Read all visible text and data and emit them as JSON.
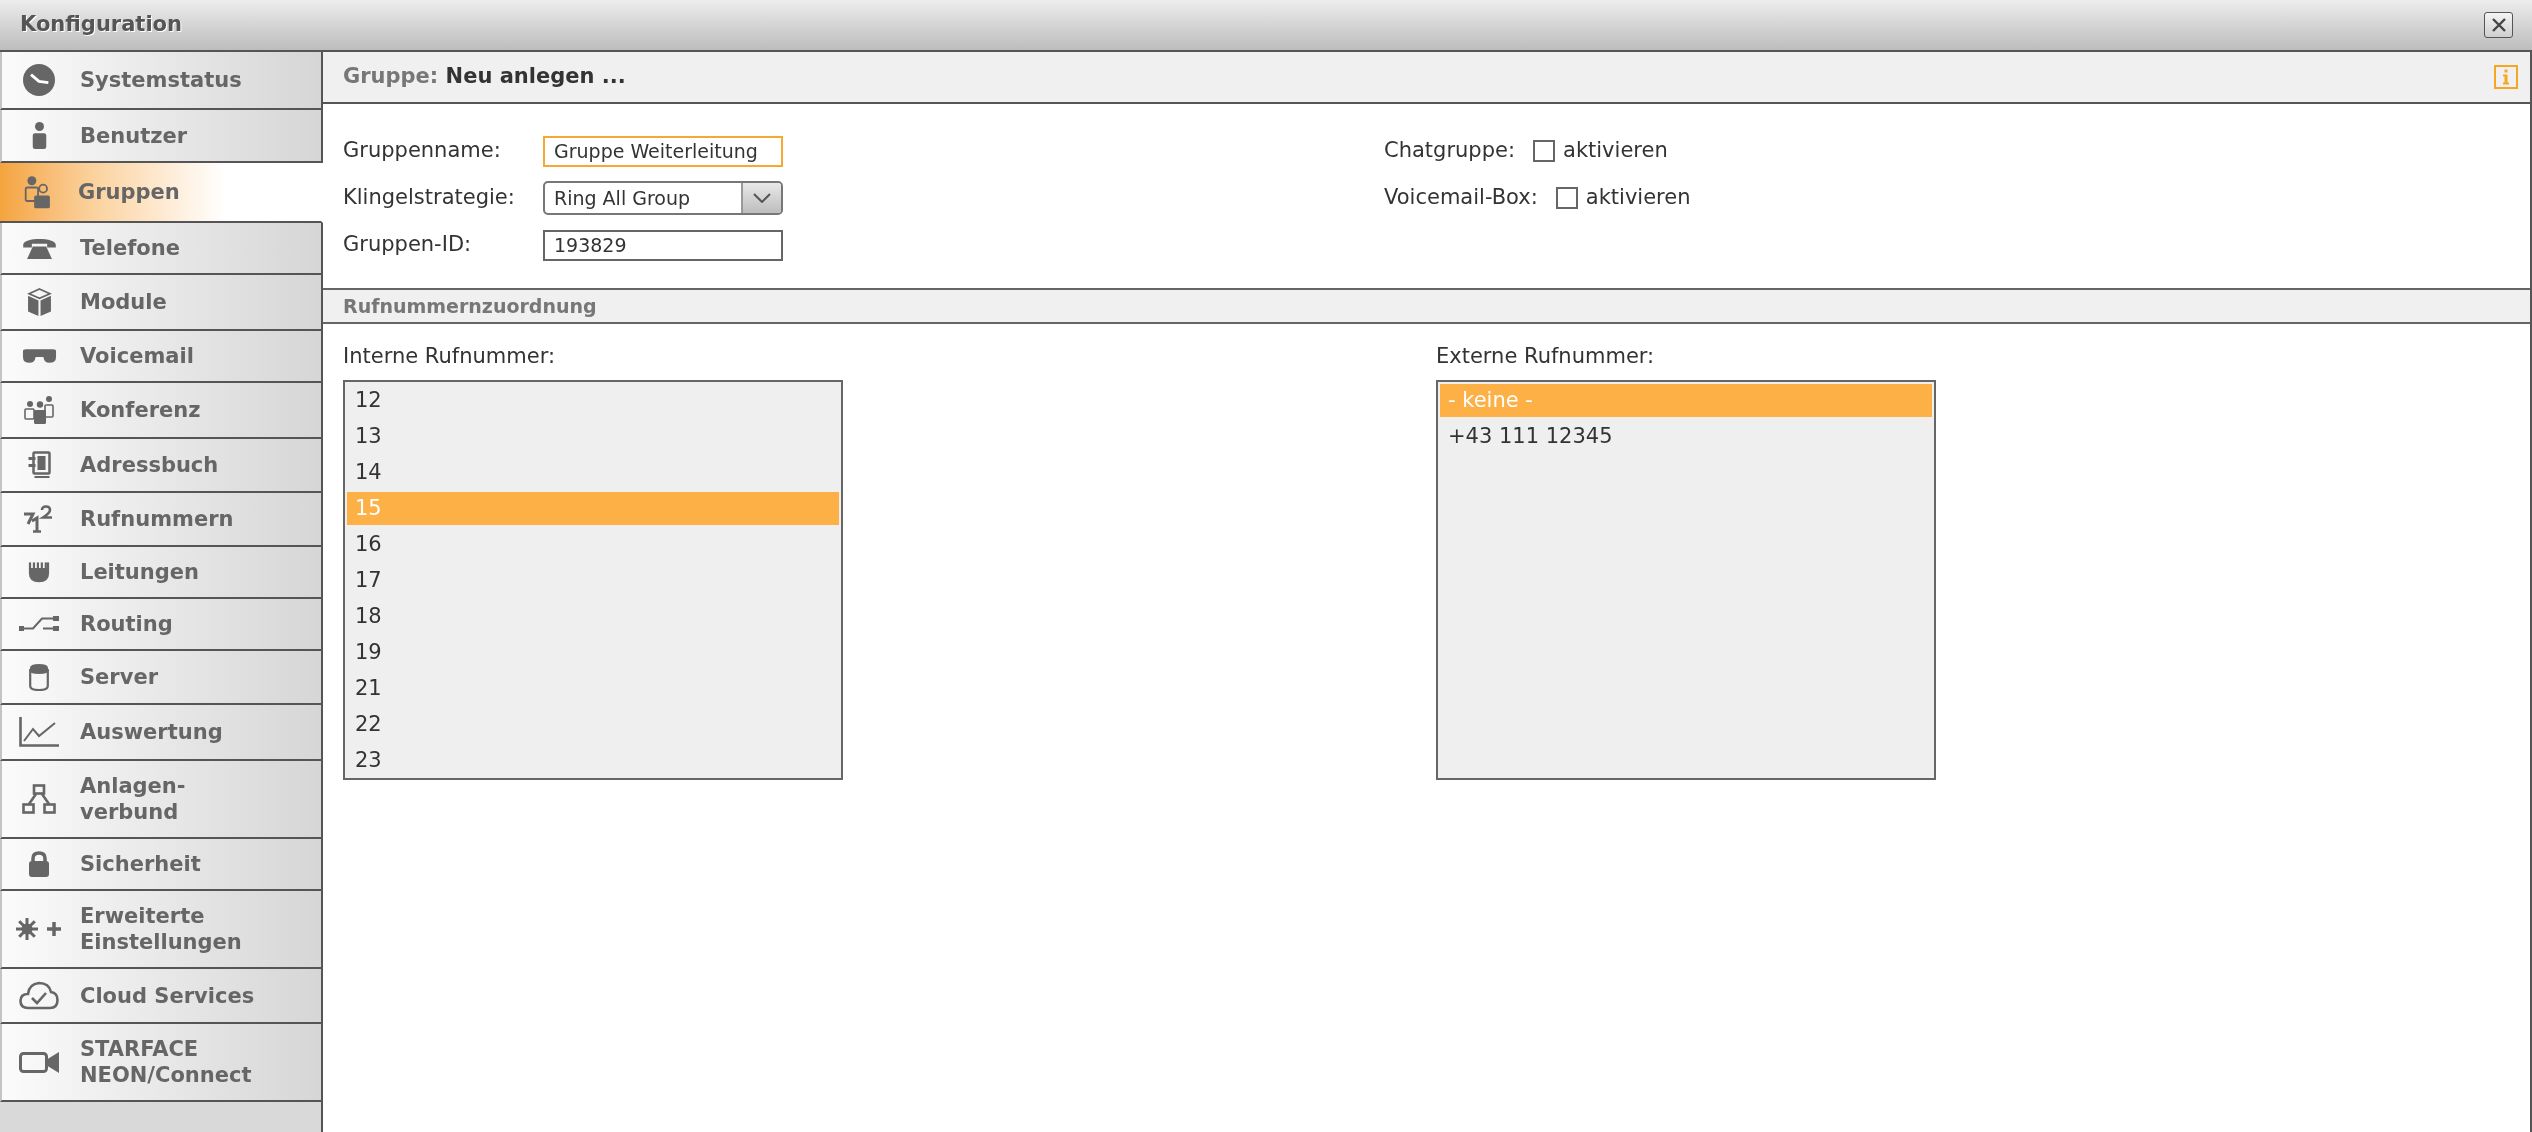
{
  "window": {
    "title": "Konfiguration"
  },
  "sidebar": {
    "items": [
      {
        "label": "Systemstatus",
        "selected": false
      },
      {
        "label": "Benutzer",
        "selected": false
      },
      {
        "label": "Gruppen",
        "selected": true
      },
      {
        "label": "Telefone",
        "selected": false
      },
      {
        "label": "Module",
        "selected": false
      },
      {
        "label": "Voicemail",
        "selected": false
      },
      {
        "label": "Konferenz",
        "selected": false
      },
      {
        "label": "Adressbuch",
        "selected": false
      },
      {
        "label": "Rufnummern",
        "selected": false
      },
      {
        "label": "Leitungen",
        "selected": false
      },
      {
        "label": "Routing",
        "selected": false
      },
      {
        "label": "Server",
        "selected": false
      },
      {
        "label": "Auswertung",
        "selected": false
      },
      {
        "label": "Anlagen-\nverbund",
        "selected": false
      },
      {
        "label": "Sicherheit",
        "selected": false
      },
      {
        "label": "Erweiterte\nEinstellungen",
        "selected": false
      },
      {
        "label": "Cloud Services",
        "selected": false
      },
      {
        "label": "STARFACE\nNEON/Connect",
        "selected": false
      }
    ]
  },
  "header": {
    "prefix": "Gruppe:",
    "title": "Neu anlegen ..."
  },
  "form": {
    "fields": [
      {
        "label": "Gruppenname:",
        "kind": "text",
        "value": "Gruppe Weiterleitung",
        "focused": true
      },
      {
        "label": "Klingelstrategie:",
        "kind": "select",
        "value": "Ring All Group"
      },
      {
        "label": "Gruppen-ID:",
        "kind": "text",
        "value": "193829",
        "focused": false
      }
    ],
    "options": [
      {
        "label": "Chatgruppe:",
        "checkbox_label": "aktivieren",
        "checked": false
      },
      {
        "label": "Voicemail-Box:",
        "checkbox_label": "aktivieren",
        "checked": false
      }
    ]
  },
  "section": {
    "title": "Rufnummernzuordnung"
  },
  "lists": [
    {
      "label": "Interne Rufnummer:",
      "items": [
        {
          "text": "12",
          "selected": false
        },
        {
          "text": "13",
          "selected": false
        },
        {
          "text": "14",
          "selected": false
        },
        {
          "text": "15",
          "selected": true
        },
        {
          "text": "16",
          "selected": false
        },
        {
          "text": "17",
          "selected": false
        },
        {
          "text": "18",
          "selected": false
        },
        {
          "text": "19",
          "selected": false
        },
        {
          "text": "21",
          "selected": false
        },
        {
          "text": "22",
          "selected": false
        },
        {
          "text": "23",
          "selected": false
        }
      ]
    },
    {
      "label": "Externe Rufnummer:",
      "items": [
        {
          "text": "- keine -",
          "selected": true
        },
        {
          "text": "+43 111 12345",
          "selected": false
        }
      ]
    }
  ]
}
